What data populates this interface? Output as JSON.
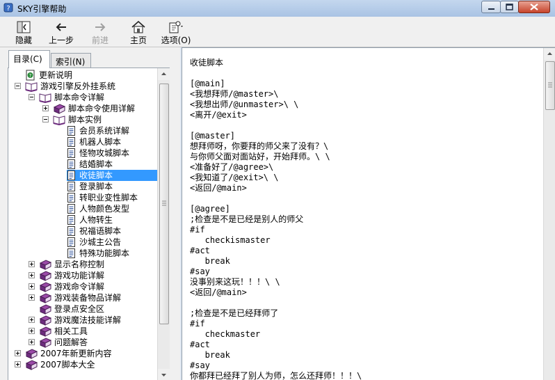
{
  "window": {
    "title": "SKY引擎帮助"
  },
  "toolbar": {
    "hide": "隐藏",
    "back": "上一步",
    "forward": "前进",
    "home": "主页",
    "options": "选项(O)"
  },
  "tabs": {
    "contents": "目录(C)",
    "index": "索引(N)"
  },
  "tree": {
    "n0": "更新说明",
    "n1": "游戏引擎反外挂系统",
    "n2": "脚本命令详解",
    "n3": "脚本命令使用详解",
    "n4": "脚本实例",
    "n5": "会员系统详解",
    "n6": "机器人脚本",
    "n7": "怪物攻城脚本",
    "n8": "结婚脚本",
    "n9": "收徒脚本",
    "n10": "登录脚本",
    "n11": "转职业变性脚本",
    "n12": "人物颜色发型",
    "n13": "人物转生",
    "n14": "祝福语脚本",
    "n15": "沙城主公告",
    "n16": "特殊功能脚本",
    "n17": "显示名称控制",
    "n18": "游戏功能详解",
    "n19": "游戏命令详解",
    "n20": "游戏装备物品详解",
    "n21": "登录点安全区",
    "n22": "游戏魔法技能详解",
    "n23": "相关工具",
    "n24": "问题解答",
    "n25": "2007年新更新内容",
    "n26": "2007脚本大全"
  },
  "content": {
    "l0": "收徒脚本",
    "l1": "",
    "l2": "[@main]",
    "l3": "<我想拜师/@master>\\",
    "l4": "<我想出师/@unmaster>\\ \\",
    "l5": "<离开/@exit>",
    "l6": "",
    "l7": "[@master]",
    "l8": "想拜师呀，你要拜的师父来了没有？\\",
    "l9": "与你师父面对面站好，开始拜师。\\ \\",
    "l10": "<准备好了/@agree>\\",
    "l11": "<我知道了/@exit>\\ \\",
    "l12": "<返回/@main>",
    "l13": "",
    "l14": "[@agree]",
    "l15": ";检查是不是已经是别人的师父",
    "l16": "#if",
    "l17": "   checkismaster",
    "l18": "#act",
    "l19": "   break",
    "l20": "#say",
    "l21": "没事别来这玩！！！\\ \\",
    "l22": "<返回/@main>",
    "l23": "",
    "l24": ";检查是不是已经拜师了",
    "l25": "#if",
    "l26": "   checkmaster",
    "l27": "#act",
    "l28": "   break",
    "l29": "#say",
    "l30": "你都拜已经拜了别人为师，怎么还拜师！！！\\"
  }
}
